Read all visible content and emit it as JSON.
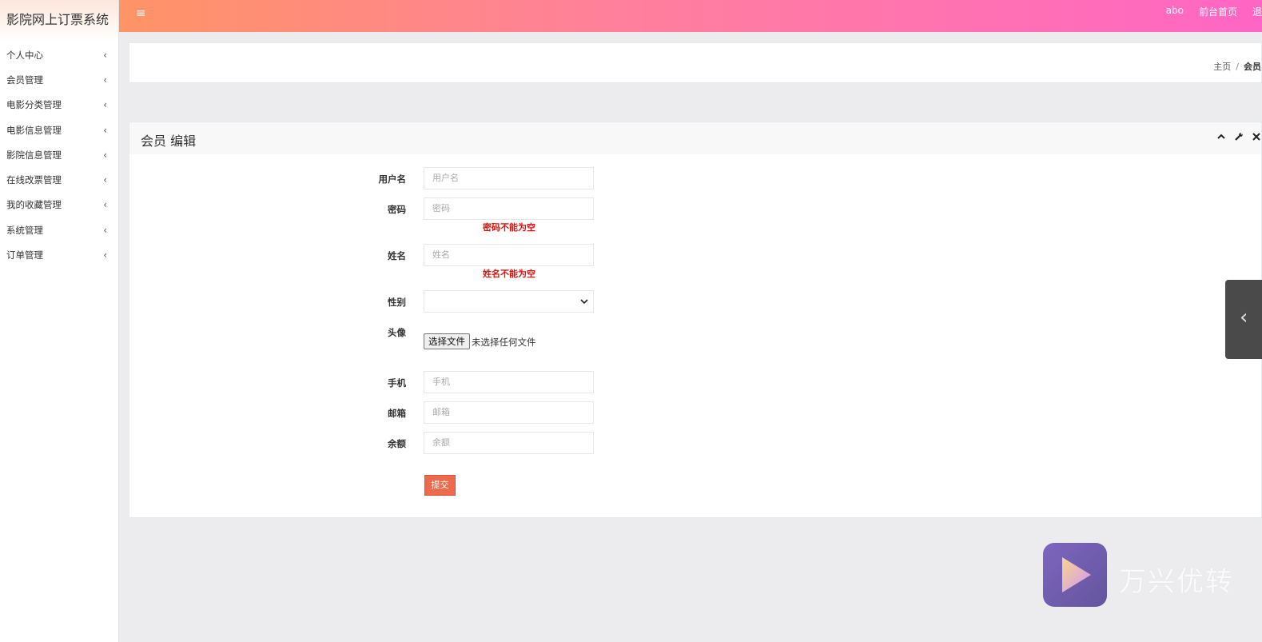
{
  "brand": "影院网上订票系统",
  "sidebar": {
    "items": [
      {
        "label": "个人中心"
      },
      {
        "label": "会员管理"
      },
      {
        "label": "电影分类管理"
      },
      {
        "label": "电影信息管理"
      },
      {
        "label": "影院信息管理"
      },
      {
        "label": "在线改票管理"
      },
      {
        "label": "我的收藏管理"
      },
      {
        "label": "系统管理"
      },
      {
        "label": "订单管理"
      }
    ],
    "arrow_icon": "chevron-left-icon"
  },
  "topbar": {
    "menu_icon": "hamburger-icon",
    "user": "abo",
    "home_link": "前台首页",
    "logout": "退"
  },
  "breadcrumb": {
    "home": "主页",
    "separator": "/",
    "current": "会员"
  },
  "card": {
    "title": "会员 编辑",
    "tools": [
      "chevron-up-icon",
      "wrench-icon",
      "close-icon"
    ]
  },
  "form": {
    "username": {
      "label": "用户名",
      "placeholder": "用户名"
    },
    "password": {
      "label": "密码",
      "placeholder": "密码",
      "error": "密码不能为空"
    },
    "name": {
      "label": "姓名",
      "placeholder": "姓名",
      "error": "姓名不能为空"
    },
    "gender": {
      "label": "性别",
      "value": ""
    },
    "avatar": {
      "label": "头像",
      "button": "选择文件",
      "status": "未选择任何文件"
    },
    "phone": {
      "label": "手机",
      "placeholder": "手机"
    },
    "email": {
      "label": "邮箱",
      "placeholder": "邮箱"
    },
    "balance": {
      "label": "余额",
      "placeholder": "余额"
    },
    "submit": "提交"
  },
  "watermark": {
    "text": "万兴优转"
  },
  "colors": {
    "topbar_start": "#ff9466",
    "topbar_end": "#ff66c4",
    "error": "#d9140f",
    "submit": "#ec6a4d"
  }
}
